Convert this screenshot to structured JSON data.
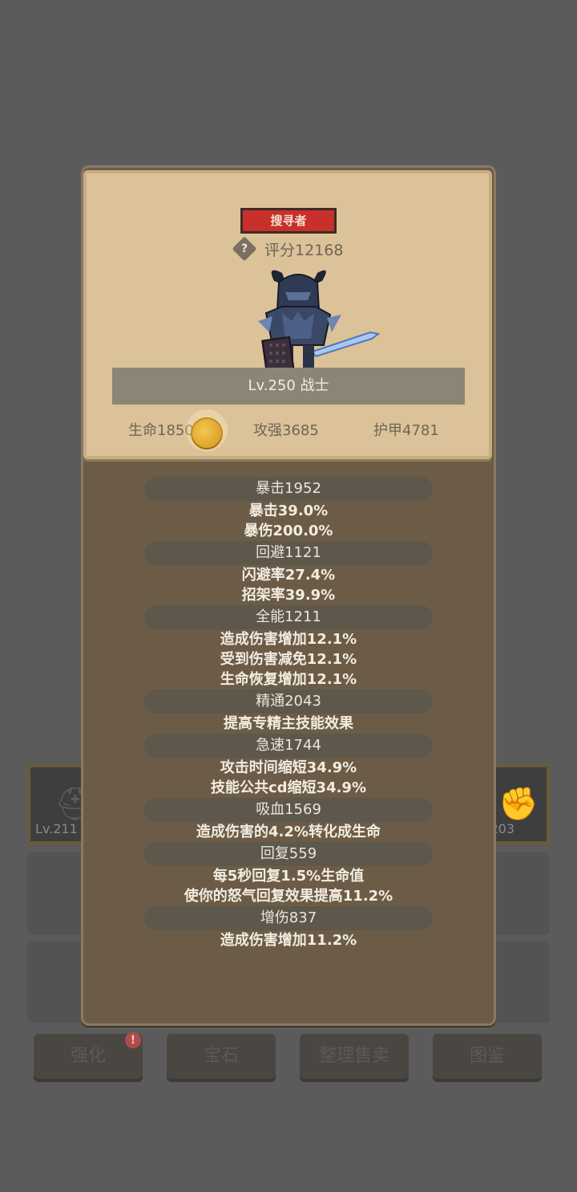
{
  "background": {
    "slots": [
      {
        "level": "Lv.211"
      },
      {
        "level": "203"
      }
    ],
    "buttons": [
      {
        "label": "强化",
        "has_alert": true,
        "alert": "!"
      },
      {
        "label": "宝石"
      },
      {
        "label": "整理售卖"
      },
      {
        "label": "图鉴"
      }
    ]
  },
  "popup": {
    "title_tag": "搜寻者",
    "help_icon": "?",
    "score": "评分12168",
    "level_class": "Lv.250 战士",
    "stats": {
      "hp": "生命1850",
      "attack": "攻强3685",
      "armor": "护甲4781"
    },
    "sections": [
      {
        "header": "暴击1952",
        "lines": [
          "暴击39.0%",
          "暴伤200.0%"
        ]
      },
      {
        "header": "回避1121",
        "lines": [
          "闪避率27.4%",
          "招架率39.9%"
        ]
      },
      {
        "header": "全能1211",
        "lines": [
          "造成伤害增加12.1%",
          "受到伤害减免12.1%",
          "生命恢复增加12.1%"
        ]
      },
      {
        "header": "精通2043",
        "lines": [
          "提高专精主技能效果"
        ]
      },
      {
        "header": "急速1744",
        "lines": [
          "攻击时间缩短34.9%",
          "技能公共cd缩短34.9%"
        ]
      },
      {
        "header": "吸血1569",
        "lines": [
          "造成伤害的4.2%转化成生命"
        ]
      },
      {
        "header": "回复559",
        "lines": [
          "每5秒回复1.5%生命值",
          "使你的怒气回复效果提高11.2%"
        ]
      },
      {
        "header": "增伤837",
        "lines": [
          "造成伤害增加11.2%"
        ]
      }
    ]
  },
  "colors": {
    "tag_red": "#c8302b",
    "parchment": "#dcc298",
    "panel_brown": "#6c5c47"
  }
}
